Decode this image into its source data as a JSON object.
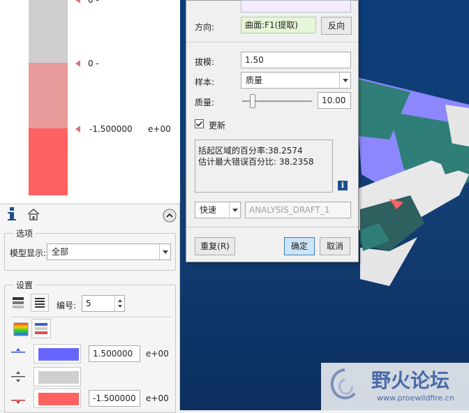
{
  "scale": {
    "labels": [
      {
        "value": "0 -",
        "exp": ""
      },
      {
        "value": "0 -",
        "exp": ""
      },
      {
        "value": "-1.500000",
        "exp": "e+00"
      }
    ],
    "colors": {
      "grey": "#cfcfcf",
      "pink": "#e89a9a",
      "red": "#ff6060"
    }
  },
  "panel_options": {
    "title": "选项",
    "model_display_label": "模型显示:",
    "model_display_value": "全部"
  },
  "panel_settings": {
    "title": "设置",
    "number_label": "编号:",
    "number_value": "5",
    "rows": [
      {
        "color": "#6666ff",
        "value": "1.500000",
        "exp": "e+00"
      },
      {
        "color": "#cfcfcf",
        "value": "",
        "exp": ""
      },
      {
        "color": "#ff6060",
        "value": "-1.500000",
        "exp": "e+00"
      }
    ]
  },
  "dialog": {
    "direction_label": "方向:",
    "direction_value": "曲面:F1(提取)",
    "reverse_button": "反向",
    "draft_label": "拔模:",
    "draft_value": "1.50",
    "sample_label": "样本:",
    "sample_value": "质量",
    "quality_label": "质量:",
    "quality_value": "10.00",
    "quality_fraction": 0.12,
    "update_label": "更新",
    "update_checked": true,
    "results_line1": "括起区域的百分率:38.2574",
    "results_line2": "估计最大错误百分比: 38.2358",
    "mode_value": "快速",
    "analysis_name": "ANALYSIS_DRAFT_1",
    "repeat_button": "重复(R)",
    "ok_button": "确定",
    "cancel_button": "取消"
  },
  "watermark": {
    "title": "野火论坛",
    "url": "www.proewildfire.cn"
  }
}
